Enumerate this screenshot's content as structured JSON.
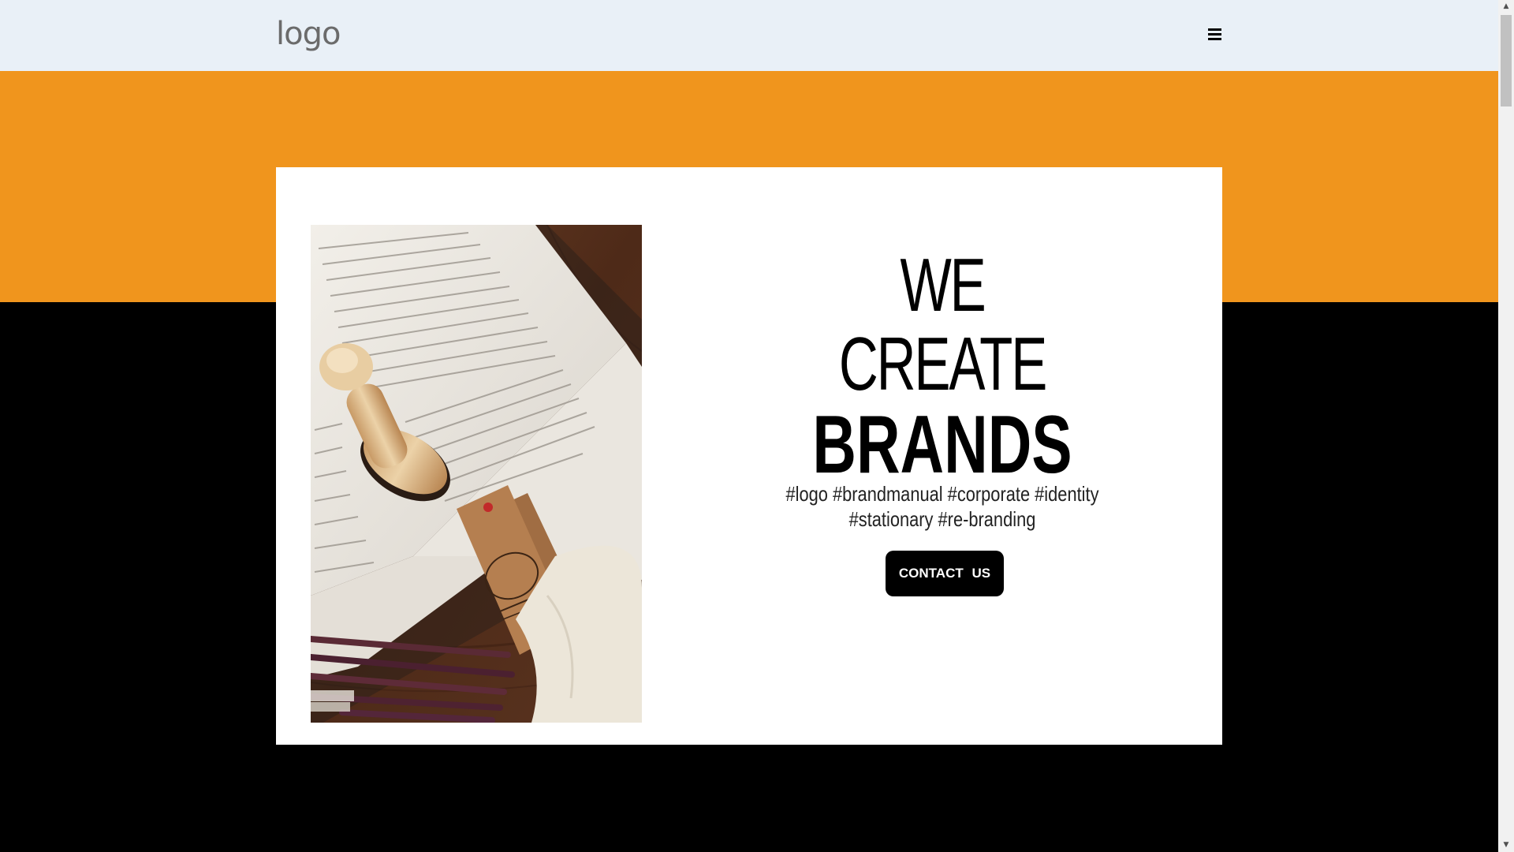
{
  "header": {
    "logo": "logo",
    "menu_icon": "hamburger-menu-icon"
  },
  "hero": {
    "headline_line1": "WE CREATE",
    "headline_line2": "BRANDS",
    "tags_line1": "#logo #brandmanual #corporate #identity",
    "tags_line2": "#stationary #re-branding",
    "cta_label": "CONTACT US",
    "image_alt": "Open book with wooden stamp, kraft tags, pencils and cotton bag"
  },
  "colors": {
    "header_bg": "#e9f0f7",
    "accent_orange": "#f0951d",
    "dark": "#000000",
    "card_bg": "#ffffff"
  }
}
